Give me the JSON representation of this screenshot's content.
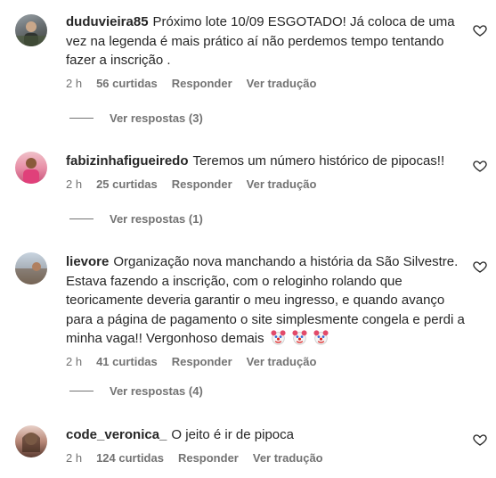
{
  "comments": [
    {
      "username": "duduvieira85",
      "text": "Próximo lote 10/09 ESGOTADO! Já coloca de uma vez na legenda é mais prático aí não perdemos tempo tentando fazer a inscrição .",
      "time": "2 h",
      "likes": "56 curtidas",
      "reply_label": "Responder",
      "translate_label": "Ver tradução",
      "view_replies": "Ver respostas (3)"
    },
    {
      "username": "fabizinhafigueiredo",
      "text": "Teremos um número histórico de pipocas!!",
      "time": "2 h",
      "likes": "25 curtidas",
      "reply_label": "Responder",
      "translate_label": "Ver tradução",
      "view_replies": "Ver respostas (1)"
    },
    {
      "username": "lievore",
      "text": "Organização nova manchando a história da São Silvestre. Estava fazendo a inscrição, com o reloginho rolando que teoricamente deveria garantir o meu ingresso, e quando avanço para a página de pagamento o site simplesmente congela e perdi a minha vaga!! Vergonhoso demais",
      "emoji_count": 3,
      "time": "2 h",
      "likes": "41 curtidas",
      "reply_label": "Responder",
      "translate_label": "Ver tradução",
      "view_replies": "Ver respostas (4)"
    },
    {
      "username": "code_veronica_",
      "text": "O jeito é ir de pipoca",
      "time": "2 h",
      "likes": "124 curtidas",
      "reply_label": "Responder",
      "translate_label": "Ver tradução"
    }
  ]
}
